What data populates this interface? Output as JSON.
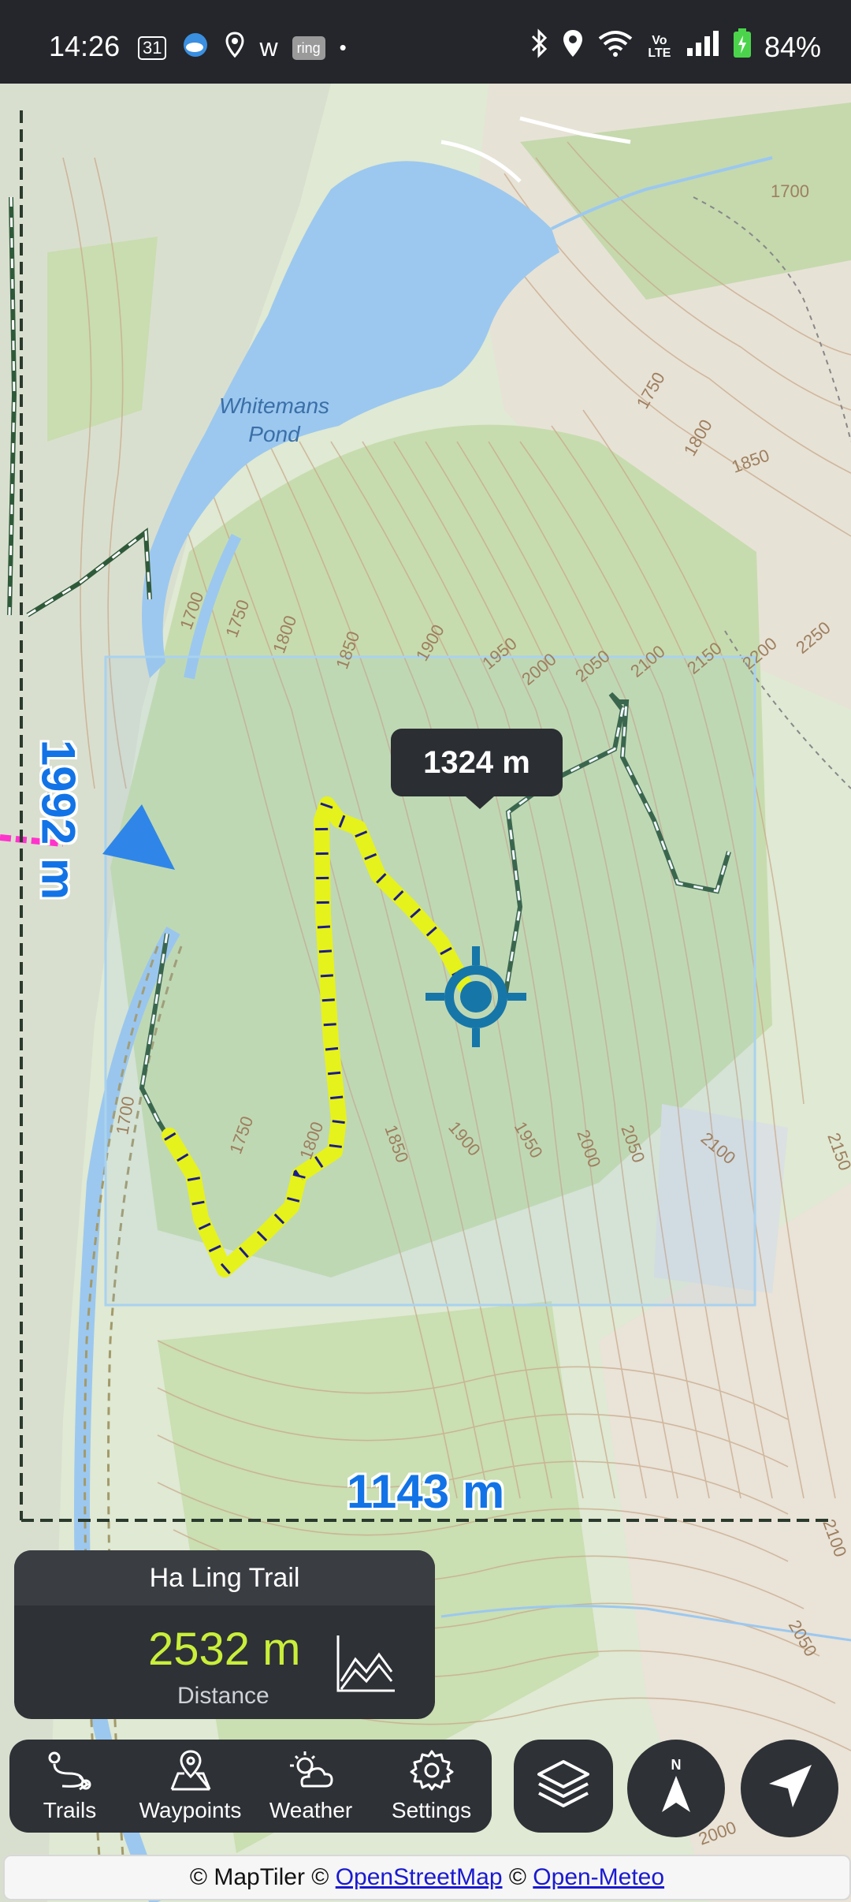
{
  "status_bar": {
    "time": "14:26",
    "left_icons": [
      "calendar-icon",
      "weather-cloud-icon",
      "location-pin-icon",
      "w-icon",
      "ring-icon",
      "dot-icon"
    ],
    "calendar_day": "31",
    "w_label": "w",
    "ring_label": "ring",
    "right_icons": [
      "bluetooth-icon",
      "location-icon",
      "wifi-icon",
      "volte-icon",
      "signal-icon",
      "battery-icon"
    ],
    "volte_label": "Vo LTE",
    "battery": "84%"
  },
  "map": {
    "lake_label_line1": "Whitemans",
    "lake_label_line2": "Pond",
    "contour_labels": [
      "1700",
      "1750",
      "1800",
      "1850",
      "1900",
      "1950",
      "2000",
      "2050",
      "2100",
      "2150",
      "2200",
      "2250",
      "1700",
      "1750",
      "1800",
      "1850",
      "1900",
      "1950",
      "2000",
      "2050",
      "2100",
      "2150",
      "1700",
      "1750",
      "1800",
      "1850",
      "1950",
      "2000",
      "2050",
      "2100"
    ],
    "tooltip_elevation": "1324 m",
    "scale_horizontal": "1143 m",
    "scale_vertical": "1992 m",
    "colors": {
      "trail_highlight": "#e6f21c",
      "trail_ticks": "#1c1c8a",
      "water": "#9cc8ef",
      "position_marker": "#1676a8",
      "scale_text": "#1273e6"
    }
  },
  "trail_card": {
    "name": "Ha Ling Trail",
    "distance": "2532 m",
    "distance_label": "Distance"
  },
  "nav": {
    "items": [
      {
        "label": "Trails",
        "icon": "trails-icon"
      },
      {
        "label": "Waypoints",
        "icon": "waypoints-icon"
      },
      {
        "label": "Weather",
        "icon": "weather-icon"
      },
      {
        "label": "Settings",
        "icon": "settings-icon"
      }
    ]
  },
  "attribution": {
    "prefix": "© MapTiler © ",
    "osm": "OpenStreetMap",
    "mid": " © ",
    "meteo": "Open-Meteo"
  }
}
